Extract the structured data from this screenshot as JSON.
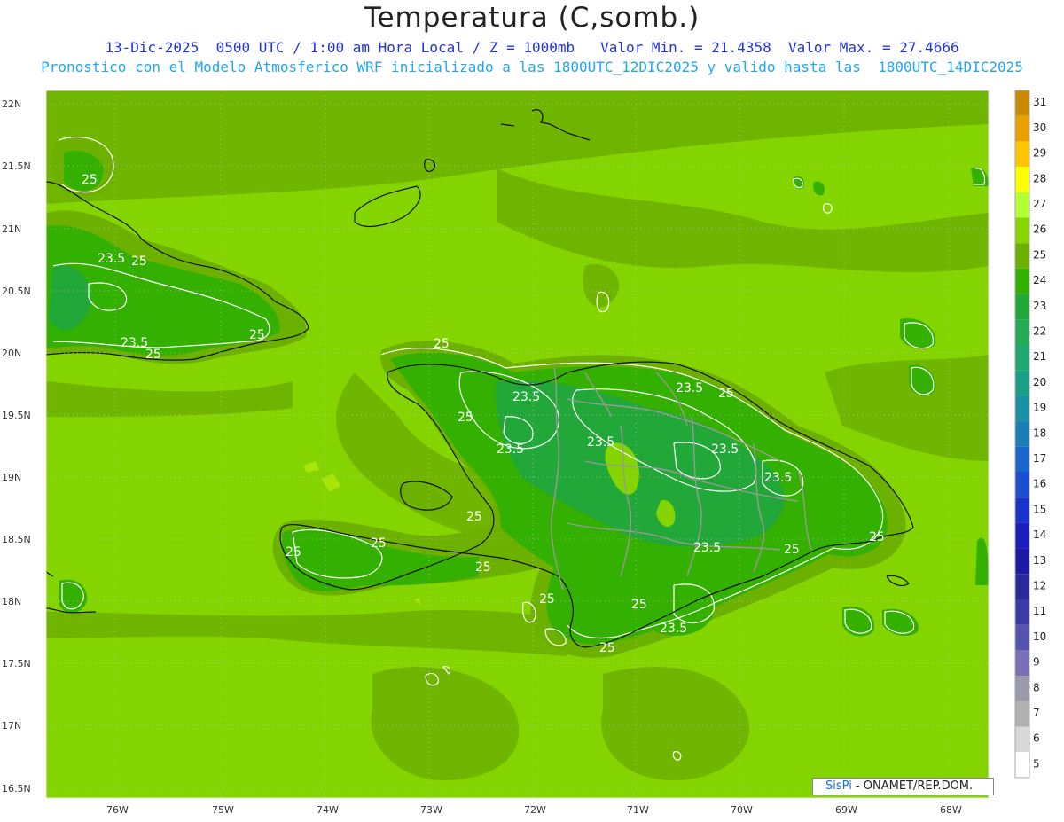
{
  "header": {
    "title": "Temperatura (C,somb.)",
    "line1": "13-Dic-2025  0500 UTC / 1:00 am Hora Local / Z = 1000mb   Valor Min. = 21.4358  Valor Max. = 27.4666",
    "line2": "Pronostico con el Modelo Atmosferico WRF inicializado a las 1800UTC_12DIC2025 y valido hasta las  1800UTC_14DIC2025"
  },
  "axes": {
    "lat_labels": [
      "22N",
      "21.5N",
      "21N",
      "20.5N",
      "20N",
      "19.5N",
      "19N",
      "18.5N",
      "18N",
      "17.5N",
      "17N",
      "16.5N"
    ],
    "lon_labels": [
      "76W",
      "75W",
      "74W",
      "73W",
      "72W",
      "71W",
      "70W",
      "69W",
      "68W"
    ]
  },
  "colorbar": {
    "labels": [
      "31",
      "30",
      "29",
      "28",
      "27",
      "26",
      "25",
      "24",
      "23",
      "22",
      "21",
      "20",
      "19",
      "18",
      "17",
      "16",
      "15",
      "14",
      "13",
      "12",
      "11",
      "10",
      "9",
      "8",
      "7",
      "6",
      "5"
    ],
    "colors": [
      "#c98a00",
      "#e8a000",
      "#ffc400",
      "#ffff00",
      "#b2ff33",
      "#88d400",
      "#6cb000",
      "#33b000",
      "#22a838",
      "#22aa55",
      "#1fa770",
      "#1ba088",
      "#1a90a0",
      "#1a7db4",
      "#1a66cc",
      "#1a4fd0",
      "#1a33cc",
      "#1a1fbb",
      "#1a1aa6",
      "#2a2a9a",
      "#3a3aa8",
      "#5555b0",
      "#7a70b8",
      "#9a9aaa",
      "#b0b0b0",
      "#d8d8d8",
      "#ffffff"
    ]
  },
  "colors": {
    "sea": "#84d400",
    "land_low": "#6cb000",
    "land_mid": "#33b000",
    "land_high": "#22a838",
    "warm_patch": "#9ee000",
    "coast": "#111111",
    "border": "#999999",
    "contour": "#ffffff"
  },
  "contour_labels": [
    "25",
    "23.5"
  ],
  "credit": {
    "brand": "SisPi",
    "text": " - ONAMET/REP.DOM."
  }
}
